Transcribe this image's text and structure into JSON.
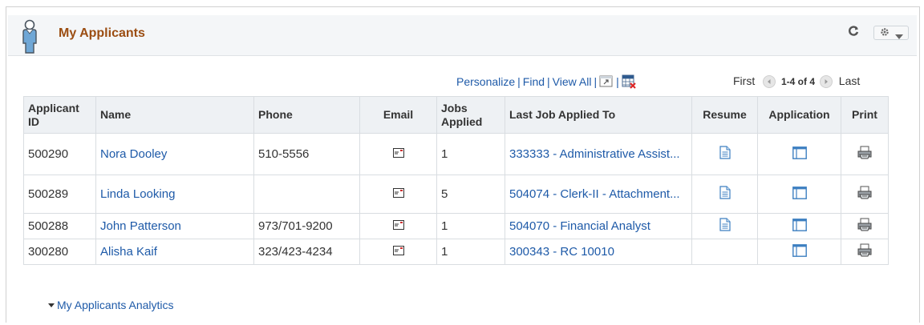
{
  "panel": {
    "title": "My Applicants",
    "header_icon": "person-icon",
    "refresh_icon": "refresh-icon",
    "gear_icon": "gear-icon"
  },
  "toolbar": {
    "personalize": "Personalize",
    "find": "Find",
    "view_all": "View All",
    "separator": "|",
    "zoom_icon": "zoom-icon",
    "download_icon": "download-to-excel-icon"
  },
  "pager": {
    "first": "First",
    "range": "1-4 of 4",
    "last": "Last"
  },
  "table": {
    "headers": {
      "applicant_id": "Applicant ID",
      "name": "Name",
      "phone": "Phone",
      "email": "Email",
      "jobs_applied": "Jobs Applied",
      "last_job": "Last Job Applied To",
      "resume": "Resume",
      "application": "Application",
      "print": "Print"
    },
    "rows": [
      {
        "id": "500290",
        "name": "Nora Dooley",
        "phone": "510-5556",
        "jobs": "1",
        "last_job": "333333 - Administrative Assist...",
        "has_resume": true
      },
      {
        "id": "500289",
        "name": "Linda Looking",
        "phone": "",
        "jobs": "5",
        "last_job": "504074 - Clerk-II - Attachment...",
        "has_resume": true
      },
      {
        "id": "500288",
        "name": "John Patterson",
        "phone": "973/701-9200",
        "jobs": "1",
        "last_job": "504070 - Financial Analyst",
        "has_resume": true
      },
      {
        "id": "300280",
        "name": "Alisha Kaif",
        "phone": "323/423-4234",
        "jobs": "1",
        "last_job": "300343 - RC 10010",
        "has_resume": false
      }
    ]
  },
  "footer": {
    "analytics_label": "My Applicants Analytics"
  },
  "colors": {
    "title": "#9b4d12",
    "link": "#1e5aa8",
    "header_bg": "#f4f6f8",
    "grid_header_bg": "#eef1f4"
  }
}
